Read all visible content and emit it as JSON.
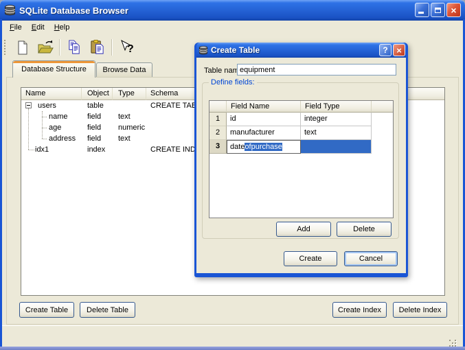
{
  "window": {
    "title": "SQLite Database Browser",
    "menu": {
      "items": [
        {
          "label": "File"
        },
        {
          "label": "Edit"
        },
        {
          "label": "Help"
        }
      ]
    },
    "toolbar": {
      "icons": [
        "new-file",
        "open-file",
        "copy",
        "paste",
        "whats-this-help"
      ]
    },
    "tabs": [
      {
        "label": "Database Structure",
        "active": true
      },
      {
        "label": "Browse Data",
        "active": false
      }
    ],
    "glyphs": {
      "close": "×",
      "help": "?"
    }
  },
  "tree": {
    "columns": [
      "Name",
      "Object",
      "Type",
      "Schema"
    ],
    "rows": [
      {
        "name": "users",
        "object": "table",
        "type": "",
        "schema": "CREATE TAB"
      },
      {
        "name": "name",
        "object": "field",
        "type": "text",
        "schema": ""
      },
      {
        "name": "age",
        "object": "field",
        "type": "numeric",
        "schema": ""
      },
      {
        "name": "address",
        "object": "field",
        "type": "text",
        "schema": ""
      },
      {
        "name": "idx1",
        "object": "index",
        "type": "",
        "schema": "CREATE IND"
      }
    ]
  },
  "buttons": {
    "create_table": "Create Table",
    "delete_table": "Delete Table",
    "create_index": "Create Index",
    "delete_index": "Delete Index"
  },
  "dialog": {
    "title": "Create Table",
    "table_name_label": "Table name:",
    "table_name_value": "equipment",
    "fields_group_label": "Define fields:",
    "grid": {
      "columns": [
        "Field Name",
        "Field Type"
      ],
      "rows": [
        {
          "num": "1",
          "field_name": "id",
          "field_type": "integer"
        },
        {
          "num": "2",
          "field_name": "manufacturer",
          "field_type": "text"
        },
        {
          "num": "3",
          "field_name_prefix": "date",
          "field_name_selected": "ofpurchase",
          "field_type": ""
        }
      ]
    },
    "buttons": {
      "add": "Add",
      "delete": "Delete",
      "create": "Create",
      "cancel": "Cancel"
    }
  },
  "colors": {
    "titlebar_blue": "#2563D6",
    "window_bg": "#ECE9D8",
    "selection_blue": "#316AC5",
    "tab_accent_orange": "#EE9738",
    "group_label_blue": "#0046D5"
  }
}
